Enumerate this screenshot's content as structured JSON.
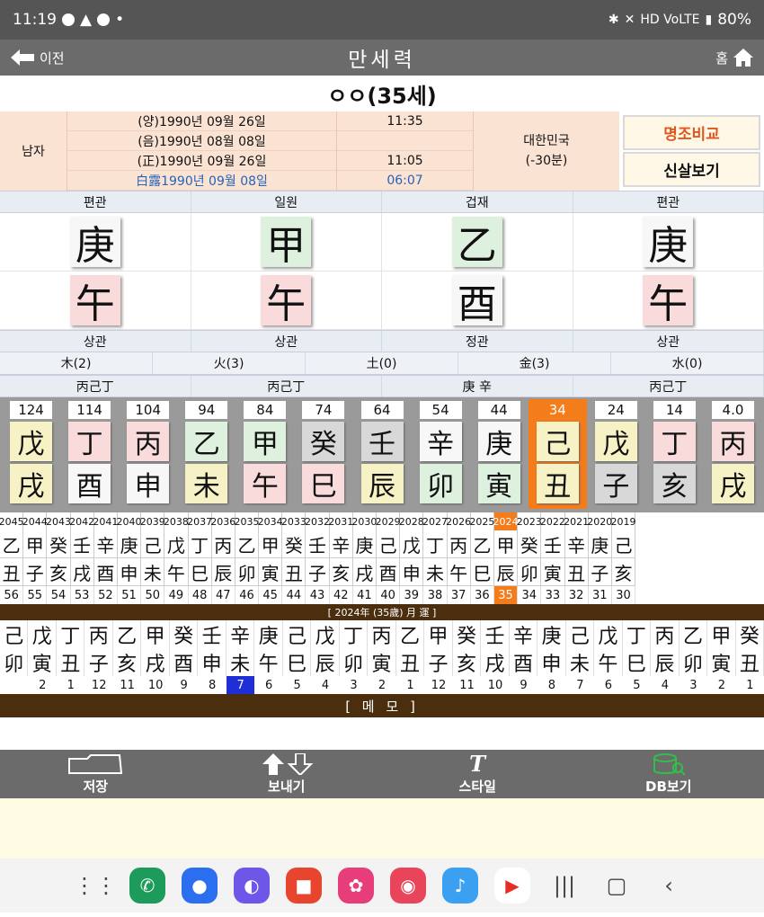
{
  "status_bar": {
    "time": "11:19",
    "signal": "HD VoLTE",
    "battery": "80%"
  },
  "title_bar": {
    "back_label": "이전",
    "title": "만세력",
    "home_label": "홈"
  },
  "person": {
    "name": "ㅇㅇ(35세)"
  },
  "info": {
    "gender": "남자",
    "dates": [
      "(양)1990년 09월 26일",
      "(음)1990년 08월 08일",
      "(正)1990년 09월 26일",
      "白露1990년 09월 08일"
    ],
    "times": [
      "11:35",
      "",
      "11:05",
      "06:07"
    ],
    "place": "대한민국",
    "offset": "(-30분)",
    "compare_btn": "명조비교",
    "sinsal_btn": "신살보기"
  },
  "pillars": [
    {
      "top_label": "편관",
      "stem": "庚",
      "branch": "午",
      "bottom_label": "상관",
      "hidden": "丙己丁"
    },
    {
      "top_label": "일원",
      "stem": "甲",
      "branch": "午",
      "bottom_label": "상관",
      "hidden": "丙己丁"
    },
    {
      "top_label": "겁재",
      "stem": "乙",
      "branch": "酉",
      "bottom_label": "정관",
      "hidden": "庚 辛"
    },
    {
      "top_label": "편관",
      "stem": "庚",
      "branch": "午",
      "bottom_label": "상관",
      "hidden": "丙己丁"
    }
  ],
  "elements": [
    "木(2)",
    "火(3)",
    "土(0)",
    "金(3)",
    "水(0)"
  ],
  "daeun": [
    {
      "age": "124",
      "stem": "戊",
      "branch": "戌"
    },
    {
      "age": "114",
      "stem": "丁",
      "branch": "酉"
    },
    {
      "age": "104",
      "stem": "丙",
      "branch": "申"
    },
    {
      "age": "94",
      "stem": "乙",
      "branch": "未"
    },
    {
      "age": "84",
      "stem": "甲",
      "branch": "午"
    },
    {
      "age": "74",
      "stem": "癸",
      "branch": "巳"
    },
    {
      "age": "64",
      "stem": "壬",
      "branch": "辰"
    },
    {
      "age": "54",
      "stem": "辛",
      "branch": "卯"
    },
    {
      "age": "44",
      "stem": "庚",
      "branch": "寅"
    },
    {
      "age": "34",
      "stem": "己",
      "branch": "丑"
    },
    {
      "age": "24",
      "stem": "戊",
      "branch": "子"
    },
    {
      "age": "14",
      "stem": "丁",
      "branch": "亥"
    },
    {
      "age": "4.0",
      "stem": "丙",
      "branch": "戌"
    }
  ],
  "yearly": {
    "years": [
      "2045",
      "2044",
      "2043",
      "2042",
      "2041",
      "2040",
      "2039",
      "2038",
      "2037",
      "2036",
      "2035",
      "2034",
      "2033",
      "2032",
      "2031",
      "2030",
      "2029",
      "2028",
      "2027",
      "2026",
      "2025",
      "2024",
      "2023",
      "2022",
      "2021",
      "2020",
      "2019"
    ],
    "stems": [
      "乙",
      "甲",
      "癸",
      "壬",
      "辛",
      "庚",
      "己",
      "戊",
      "丁",
      "丙",
      "乙",
      "甲",
      "癸",
      "壬",
      "辛",
      "庚",
      "己",
      "戊",
      "丁",
      "丙",
      "乙",
      "甲",
      "癸",
      "壬",
      "辛",
      "庚",
      "己"
    ],
    "branches": [
      "丑",
      "子",
      "亥",
      "戌",
      "酉",
      "申",
      "未",
      "午",
      "巳",
      "辰",
      "卯",
      "寅",
      "丑",
      "子",
      "亥",
      "戌",
      "酉",
      "申",
      "未",
      "午",
      "巳",
      "辰",
      "卯",
      "寅",
      "丑",
      "子",
      "亥"
    ],
    "ages": [
      "56",
      "55",
      "54",
      "53",
      "52",
      "51",
      "50",
      "49",
      "48",
      "47",
      "46",
      "45",
      "44",
      "43",
      "42",
      "41",
      "40",
      "39",
      "38",
      "37",
      "36",
      "35",
      "34",
      "33",
      "32",
      "31",
      "30"
    ]
  },
  "monthly": {
    "title": "[ 2024年 (35歲) 月 運 ]",
    "stems": [
      "己",
      "戊",
      "丁",
      "丙",
      "乙",
      "甲",
      "癸",
      "壬",
      "辛",
      "庚",
      "己",
      "戊",
      "丁",
      "丙",
      "乙",
      "甲",
      "癸",
      "壬",
      "辛",
      "庚",
      "己",
      "戊",
      "丁",
      "丙",
      "乙",
      "甲",
      "癸"
    ],
    "branches": [
      "卯",
      "寅",
      "丑",
      "子",
      "亥",
      "戌",
      "酉",
      "申",
      "未",
      "午",
      "巳",
      "辰",
      "卯",
      "寅",
      "丑",
      "子",
      "亥",
      "戌",
      "酉",
      "申",
      "未",
      "午",
      "巳",
      "辰",
      "卯",
      "寅",
      "丑"
    ],
    "months": [
      "",
      "2",
      "1",
      "12",
      "11",
      "10",
      "9",
      "8",
      "7",
      "6",
      "5",
      "4",
      "3",
      "2",
      "1",
      "12",
      "11",
      "10",
      "9",
      "8",
      "7",
      "6",
      "5",
      "4",
      "3",
      "2",
      "1"
    ]
  },
  "memo_label": "[ 메 모 ]",
  "toolbar": {
    "save": "저장",
    "send": "보내기",
    "style": "스타일",
    "db": "DB보기"
  }
}
